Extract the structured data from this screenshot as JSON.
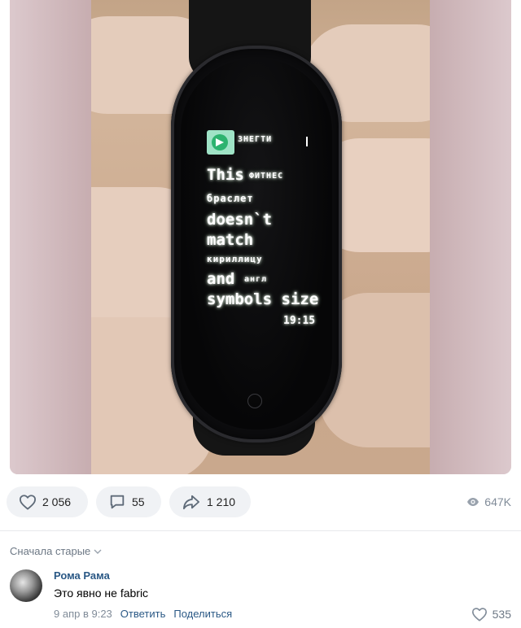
{
  "photo": {
    "watch_screen": {
      "app_name": "ЗНЕГТИ",
      "lines": [
        {
          "text": "This",
          "style": "big"
        },
        {
          "text": "ФИТНЕС",
          "style": "small"
        },
        {
          "text": "браслет",
          "style": "small"
        },
        {
          "text": "doesn`t",
          "style": "big"
        },
        {
          "text": "match",
          "style": "big"
        },
        {
          "text": "кириллицу",
          "style": "small"
        },
        {
          "text": "and",
          "style": "big"
        },
        {
          "text": "англ",
          "style": "small"
        },
        {
          "text": "symbols size",
          "style": "big"
        }
      ],
      "time": "19:15"
    }
  },
  "actions": {
    "likes": {
      "icon": "heart-icon",
      "count": "2 056"
    },
    "comments": {
      "icon": "comment-icon",
      "count": "55"
    },
    "shares": {
      "icon": "share-icon",
      "count": "1 210"
    },
    "views": {
      "icon": "eye-icon",
      "count": "647K"
    }
  },
  "comments_section": {
    "sort_label": "Сначала старые",
    "comments": [
      {
        "author": "Рома Рама",
        "text": "Это явно не fabric",
        "date": "9 апр в 9:23",
        "reply_label": "Ответить",
        "share_label": "Поделиться",
        "likes": "535"
      }
    ]
  },
  "colors": {
    "link": "#2a5885",
    "muted": "#818c99",
    "pill_bg": "#f0f2f5"
  }
}
